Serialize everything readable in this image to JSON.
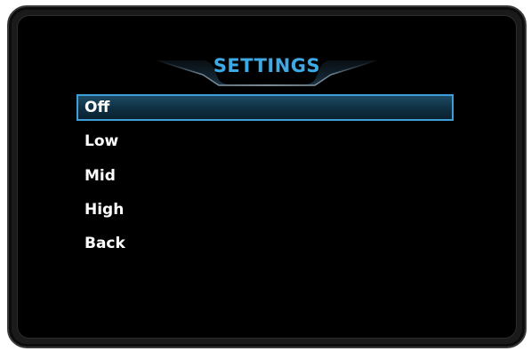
{
  "title": "SETTINGS",
  "menu": {
    "items": [
      {
        "label": "Off",
        "selected": true
      },
      {
        "label": "Low",
        "selected": false
      },
      {
        "label": "Mid",
        "selected": false
      },
      {
        "label": "High",
        "selected": false
      },
      {
        "label": "Back",
        "selected": false
      }
    ]
  },
  "colors": {
    "accent": "#3fa9e6",
    "selection_border": "#3e9fd6",
    "background": "#000000",
    "text": "#ffffff"
  }
}
